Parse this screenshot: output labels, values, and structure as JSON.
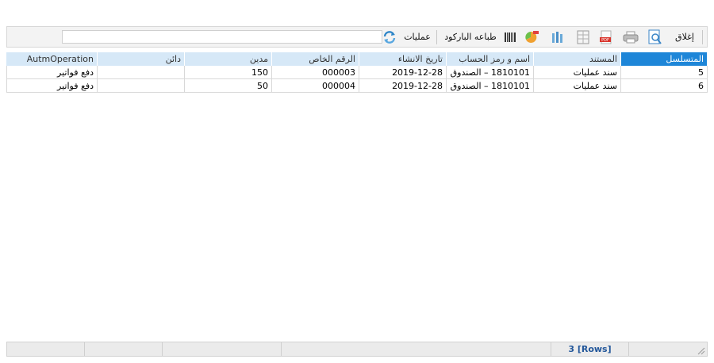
{
  "toolbar": {
    "close_label": "إغلاق",
    "barcode_print_label": "طباعه الباركود",
    "operations_label": "عمليات",
    "search_value": "",
    "icons": [
      "preview-icon",
      "print-icon",
      "pdf-icon",
      "excel-icon",
      "columns-icon",
      "chart-icon",
      "barcode-icon",
      "refresh-icon"
    ]
  },
  "grid": {
    "columns": [
      "المتسلسل",
      "المستند",
      "اسم و رمز الحساب",
      "تاريخ الانشاء",
      "الرقم الخاص",
      "مدين",
      "دائن",
      "AutmOperation"
    ],
    "rows": [
      {
        "serial": "5",
        "document": "سند عمليات",
        "account": "1810101 – الصندوق",
        "created": "2019-12-28",
        "private_no": "000003",
        "debit": "150",
        "credit": "",
        "operation": "دفع فواتير"
      },
      {
        "serial": "6",
        "document": "سند عمليات",
        "account": "1810101 – الصندوق",
        "created": "2019-12-28",
        "private_no": "000004",
        "debit": "50",
        "credit": "",
        "operation": "دفع فواتير"
      }
    ]
  },
  "status": {
    "rows_text": "3 [Rows]"
  },
  "colors": {
    "header_bg": "#d6e8f7",
    "active_header_bg": "#1e86d8",
    "rows_text": "#23579a"
  }
}
